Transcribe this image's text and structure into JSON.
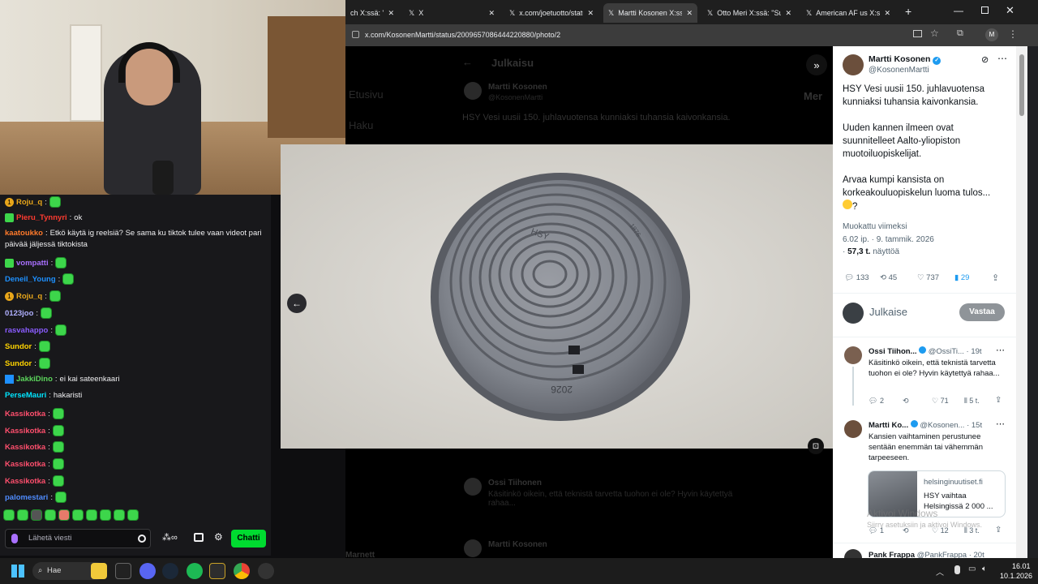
{
  "webcam": {},
  "chat": {
    "messages": [
      {
        "name": "Roju_q",
        "color": "#e8a61a",
        "text": "",
        "emote": true,
        "badge": "1"
      },
      {
        "name": "Pieru_Tynnyri",
        "color": "#ff3b30",
        "text": "ok",
        "emote": false,
        "badge": "bottle"
      },
      {
        "name": "kaatoukko",
        "color": "#ff7a2b",
        "text": "Etkö käytä ig reelsiä? Se sama ku tiktok tulee vaan videot pari",
        "text2": "päivää jäljessä tiktokista",
        "emote": false
      },
      {
        "name": "vompatti",
        "color": "#a970ff",
        "text": "",
        "emote": true,
        "badge": "green"
      },
      {
        "name": "Deneil_Young",
        "color": "#1e90ff",
        "text": "",
        "emote": true
      },
      {
        "name": "Roju_q",
        "color": "#e8a61a",
        "text": "",
        "emote": true,
        "badge": "1"
      },
      {
        "name": "0123joo",
        "color": "#b0b0ff",
        "text": "",
        "emote": true
      },
      {
        "name": "rasvahappo",
        "color": "#8a5cff",
        "text": "",
        "emote": true
      },
      {
        "name": "Sundor",
        "color": "#ffd400",
        "text": "",
        "emote": true
      },
      {
        "name": "Sundor",
        "color": "#ffd400",
        "text": "",
        "emote": true
      },
      {
        "name": "JakkiDino",
        "color": "#5cd65c",
        "text": "ei kai sateenkaari",
        "emote": false,
        "badge": "blue"
      },
      {
        "name": "PerseMauri",
        "color": "#00e5ff",
        "text": "hakaristi",
        "emote": false
      },
      {
        "name": "Kassikotka",
        "color": "#ff4f6d",
        "text": "",
        "emote": true
      },
      {
        "name": "Kassikotka",
        "color": "#ff4f6d",
        "text": "",
        "emote": true
      },
      {
        "name": "Kassikotka",
        "color": "#ff4f6d",
        "text": "",
        "emote": true
      },
      {
        "name": "Kassikotka",
        "color": "#ff4f6d",
        "text": "",
        "emote": true
      },
      {
        "name": "Kassikotka",
        "color": "#ff4f6d",
        "text": "",
        "emote": true
      },
      {
        "name": "palomestari",
        "color": "#4f8cff",
        "text": "",
        "emote": true
      }
    ],
    "input_placeholder": "Lähetä viesti",
    "chat_button": "Chatti"
  },
  "browser": {
    "tabs": [
      {
        "label": "ch X:ssä: \" 🇬🇧"
      },
      {
        "label": "X"
      },
      {
        "label": "x.com/joetuotto/statu"
      },
      {
        "label": "Martti Kosonen X:ssä:",
        "active": true
      },
      {
        "label": "Otto Meri X:ssä: \"Suo"
      },
      {
        "label": "American AF us X:ssä"
      }
    ],
    "url": "x.com/KosonenMartti/status/2009657086444220880/photo/2",
    "profile_letter": "M"
  },
  "tweet": {
    "author_name": "Martti Kosonen",
    "author_handle": "@KosonenMartti",
    "text_p1": "HSY Vesi uusii 150. juhlavuotensa kunniaksi tuhansia kaivonkansia.",
    "text_p2": "Uuden kannen ilmeen ovat suunnitelleet Aalto-yliopiston muotoiluopiskelijat.",
    "text_p3": "Arvaa kumpi kansista on korkeakouluopiskelun luoma tulos...",
    "text_p3b": "?",
    "edited": "Muokattu viimeksi",
    "timestamp": "6.02 ip. · 9. tammik. 2026",
    "views": "57,3 t.",
    "views_label": "näyttöä",
    "replies": "133",
    "retweets": "45",
    "likes": "737",
    "bookmarks": "29",
    "reply_placeholder": "Julkaise",
    "reply_button": "Vastaa"
  },
  "replies": [
    {
      "name": "Ossi Tiihon...",
      "handle": "@OssiTi...",
      "time": "· 19t",
      "text": "Käsitinkö oikein, että teknistä tarvetta tuohon ei ole? Hyvin käytettyä rahaa...",
      "replies": "2",
      "retweets": "",
      "likes": "71",
      "views": "5 t."
    },
    {
      "name": "Martti Ko...",
      "handle": "@Kosonen...",
      "time": "· 15t",
      "text": "Kansien vaihtaminen perustunee sentään enemmän tai vähemmän tarpeeseen.",
      "card_domain": "helsinginuutiset.fi",
      "card_title": "HSY vaihtaa Helsingissä 2 000 ...",
      "replies": "1",
      "retweets": "",
      "likes": "12",
      "views": "3 t."
    },
    {
      "name": "Pank Frappa",
      "handle": "@PankFrappa",
      "time": "· 20t"
    }
  ],
  "background_tweet": {
    "header": "Julkaisu",
    "author": "Martti Kosonen",
    "handle": "@KosonenMartti",
    "text": "HSY Vesi uusii 150. juhlavuotensa kunniaksi tuhansia kaivonkansia.",
    "reply1_author": "Ossi Tiihonen",
    "reply1_text": "Käsitinkö oikein, että teknistä tarvetta tuohon ei ole? Hyvin käytettyä rahaa...",
    "reply2_author": "Martti Kosonen",
    "side1": "Etusivu",
    "side2": "Haku",
    "side_right": "Mer",
    "bottom_left": "Marnett"
  },
  "photo": {
    "cover_label_top": "HSY",
    "cover_year": "2026",
    "cover_side": "1876"
  },
  "watermark": {
    "line1": "Aktivoi Windows",
    "line2": "Siirry asetuksiin ja aktivoi Windows."
  },
  "taskbar": {
    "search_label": "Hae",
    "time": "16.01",
    "date": "10.1.2026"
  }
}
